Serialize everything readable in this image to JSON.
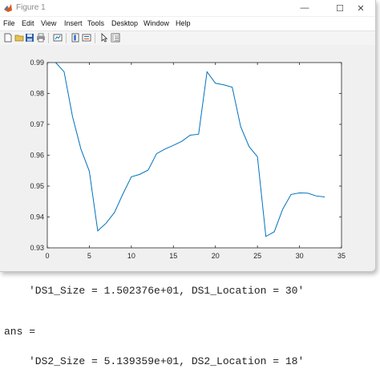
{
  "window": {
    "title": "Figure 1",
    "minimize_symbol": "—",
    "maximize_symbol": "☐",
    "close_symbol": "✕"
  },
  "menu": {
    "items": [
      "File",
      "Edit",
      "View",
      "Insert",
      "Tools",
      "Desktop",
      "Window",
      "Help"
    ]
  },
  "toolbar": {
    "icons": [
      "new-figure-icon",
      "open-file-icon",
      "save-icon",
      "print-icon",
      "link-plot-icon",
      "insert-colorbar-icon",
      "insert-legend-icon",
      "pointer-icon",
      "property-inspector-icon"
    ]
  },
  "console": {
    "line1": "'DS1_Size = 1.502376e+01, DS1_Location = 30'",
    "line2": "ans =",
    "line3": "'DS2_Size = 5.139359e+01, DS2_Location = 18'"
  },
  "chart_data": {
    "type": "line",
    "series": [
      {
        "color": "#0072bd",
        "x": [
          1,
          2,
          3,
          4,
          5,
          6,
          7,
          8,
          9,
          10,
          11,
          12,
          13,
          14,
          15,
          16,
          17,
          18,
          19,
          20,
          21,
          22,
          23,
          24,
          25,
          26,
          27,
          28,
          29,
          30,
          31,
          32,
          33
        ],
        "y": [
          0.99,
          0.987,
          0.9725,
          0.962,
          0.9548,
          0.9355,
          0.938,
          0.9415,
          0.9475,
          0.953,
          0.9538,
          0.9552,
          0.9605,
          0.962,
          0.9632,
          0.9645,
          0.9665,
          0.9668,
          0.987,
          0.9833,
          0.9828,
          0.982,
          0.9693,
          0.9628,
          0.9595,
          0.9337,
          0.9352,
          0.9425,
          0.9473,
          0.9478,
          0.9477,
          0.9468,
          0.9465
        ]
      }
    ],
    "xlim": [
      0,
      35
    ],
    "ylim": [
      0.93,
      0.99
    ],
    "xticks": [
      0,
      5,
      10,
      15,
      20,
      25,
      30,
      35
    ],
    "yticks": [
      0.93,
      0.94,
      0.95,
      0.96,
      0.97,
      0.98,
      0.99
    ],
    "xtick_labels": [
      "0",
      "5",
      "10",
      "15",
      "20",
      "25",
      "30",
      "35"
    ],
    "ytick_labels": [
      "0.93",
      "0.94",
      "0.95",
      "0.96",
      "0.97",
      "0.98",
      "0.99"
    ],
    "grid": false,
    "title": "",
    "xlabel": "",
    "ylabel": ""
  }
}
